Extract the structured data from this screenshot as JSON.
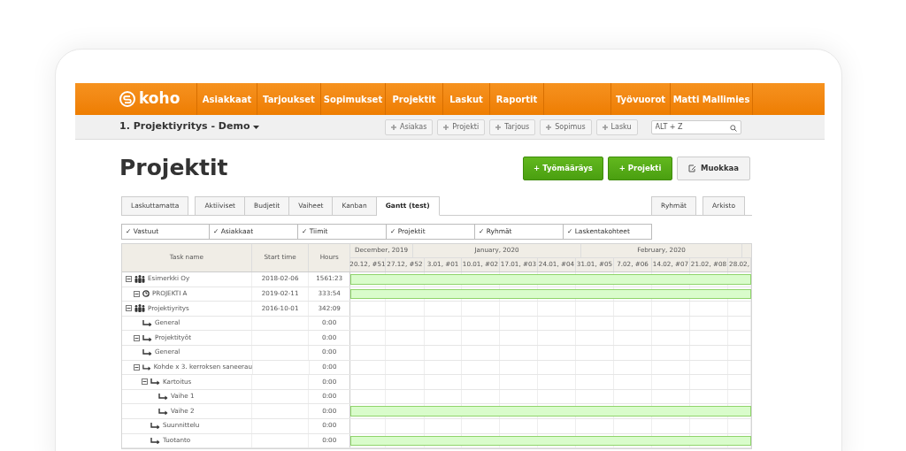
{
  "nav": {
    "logo": "koho",
    "items": [
      {
        "label": "Asiakkaat"
      },
      {
        "label": "Tarjoukset"
      },
      {
        "label": "Sopimukset"
      },
      {
        "label": "Projektit"
      },
      {
        "label": "Laskut"
      },
      {
        "label": "Raportit"
      }
    ],
    "right_items": [
      {
        "label": "Työvuorot"
      },
      {
        "label": "Matti Mallimies"
      }
    ]
  },
  "subbar": {
    "company": "1. Projektiyritys - Demo",
    "shortcuts": [
      "Asiakas",
      "Projekti",
      "Tarjous",
      "Sopimus",
      "Lasku"
    ],
    "search": {
      "placeholder": "ALT + Z"
    }
  },
  "page_title": "Projektit",
  "actions": [
    {
      "label": "+ Työmääräys",
      "kind": "primary"
    },
    {
      "label": "+ Projekti",
      "kind": "primary"
    },
    {
      "label": "Muokkaa",
      "kind": "edit"
    }
  ],
  "tab_groups": [
    {
      "tabs": [
        {
          "label": "Laskuttamatta",
          "selected": false
        }
      ]
    },
    {
      "tabs": [
        {
          "label": "Aktiiviset",
          "selected": false
        },
        {
          "label": "Budjetit",
          "selected": false
        },
        {
          "label": "Vaiheet",
          "selected": false
        },
        {
          "label": "Kanban",
          "selected": false
        },
        {
          "label": "Gantt (test)",
          "selected": true
        }
      ]
    },
    {
      "tabs": [
        {
          "label": "Ryhmät",
          "selected": false
        },
        {
          "label": "Arkisto",
          "selected": false
        }
      ]
    }
  ],
  "filters": [
    "✓ Vastuut",
    "✓ Asiakkaat",
    "✓ Tiimit",
    "✓ Projektit",
    "✓ Ryhmät",
    "✓ Laskentakohteet"
  ],
  "gantt": {
    "columns": [
      "Task name",
      "Start time",
      "Hours"
    ],
    "months": [
      "December, 2019",
      "January, 2020",
      "February, 2020"
    ],
    "weeks": [
      "20.12, #51",
      "27.12, #52",
      "3.01, #01",
      "10.01, #02",
      "17.01, #03",
      "24.01, #04",
      "31.01, #05",
      "7.02, #06",
      "14.02, #07",
      "21.02, #08",
      "28.02,"
    ],
    "rows": [
      {
        "name": "Esimerkki Oy",
        "kind": "company",
        "start": "2018-02-06",
        "hours": "1561:23",
        "expanded": true,
        "bar": true,
        "children": [
          {
            "name": "PROJEKTI A",
            "kind": "project",
            "start": "2019-02-11",
            "hours": "333:54",
            "expanded": true,
            "bar": true
          }
        ]
      },
      {
        "name": "Projektiyritys",
        "kind": "company",
        "start": "2016-10-01",
        "hours": "342:09",
        "expanded": true,
        "bar": false,
        "children": [
          {
            "name": "General",
            "kind": "task",
            "hours": "0:00",
            "bar": false
          },
          {
            "name": "Projektityöt",
            "kind": "task",
            "hours": "0:00",
            "expanded": true,
            "bar": false
          },
          {
            "name": "General",
            "kind": "task",
            "hours": "0:00",
            "bar": false
          },
          {
            "name": "Kohde x 3. kerroksen saneerau",
            "kind": "task",
            "hours": "0:00",
            "expanded": true,
            "bar": false,
            "children": [
              {
                "name": "Kartoitus",
                "kind": "task",
                "hours": "0:00",
                "expanded": true,
                "bar": false,
                "children": [
                  {
                    "name": "Vaihe 1",
                    "kind": "task",
                    "hours": "0:00",
                    "bar": false
                  },
                  {
                    "name": "Vaihe 2",
                    "kind": "task",
                    "hours": "0:00",
                    "bar": true
                  }
                ]
              },
              {
                "name": "Suunnittelu",
                "kind": "task",
                "hours": "0:00",
                "bar": false
              },
              {
                "name": "Tuotanto",
                "kind": "task",
                "hours": "0:00",
                "bar": true
              }
            ]
          }
        ]
      }
    ]
  }
}
